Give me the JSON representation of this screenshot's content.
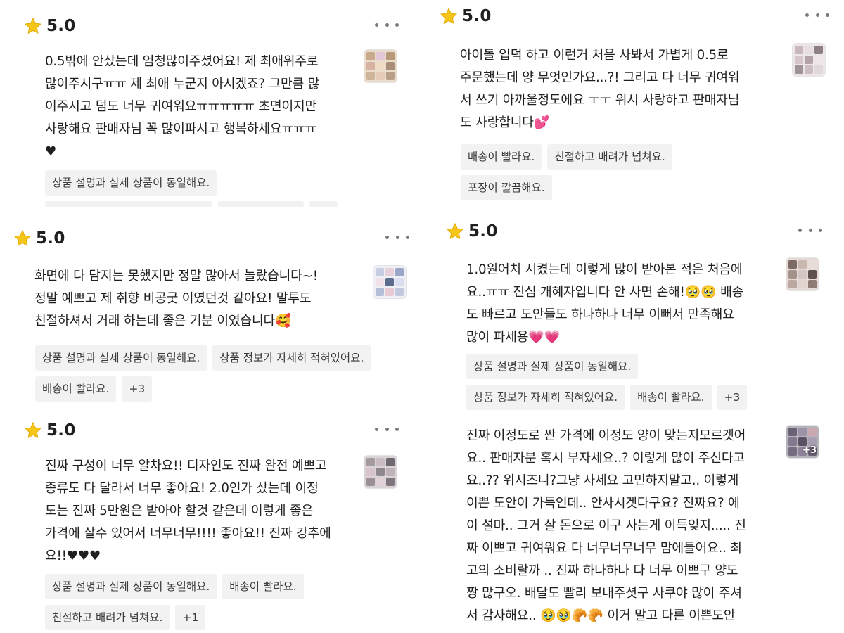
{
  "colors": {
    "star": "#f5c518",
    "tag_bg": "#f2f2f2",
    "text": "#1f1f1f",
    "dots": "#7a7a7a"
  },
  "reviews": [
    {
      "rating": "5.0",
      "text": [
        "0.5밖에 안샀는데 엄청많이주셨어요! 제 최애위주로",
        "많이주시구ㅠㅠ 제 최애 누군지 아시겠죠? 그만큼 많",
        "이주시고 덤도 너무 귀여워요ㅠㅠㅠㅠㅠ 초면이지만",
        "사랑해요 판매자님 꼭 많이파시고 행복하세요ㅠㅠㅠ",
        "♥"
      ],
      "tags": [
        "상품 설명과 실제 상품이 동일해요."
      ],
      "icon": "star-icon"
    },
    {
      "rating": "5.0",
      "text": [
        "화면에 다 담지는 못했지만 정말 많아서 놀랐습니다~!",
        "정말 예쁘고 제 취향 비공굿 이였던것 같아요! 말투도",
        "친절하셔서 거래 하는데 좋은 기분 이였습니다🥰"
      ],
      "tags": [
        "상품 설명과 실제 상품이 동일해요.",
        "상품 정보가 자세히 적혀있어요.",
        "배송이 빨라요.",
        "+3"
      ]
    },
    {
      "rating": "5.0",
      "text": [
        "진짜 구성이 너무 알차요!! 디자인도 진짜 완전 예쁘고",
        "종류도 다 달라서 너무 좋아요! 2.0인가 샀는데 이정",
        "도는 진짜 5만원은 받아야 할것 같은데 이렇게 좋은",
        "가격에 살수 있어서 너무너무!!!! 좋아요!! 진짜 강추에",
        "요!!♥♥♥"
      ],
      "tags": [
        "상품 설명과 실제 상품이 동일해요.",
        "배송이 빨라요.",
        "친절하고 배려가 넘쳐요.",
        "+1"
      ]
    },
    {
      "rating": "5.0",
      "text": [
        "아이돌 입덕 하고 이런거 처음 사봐서 가볍게 0.5로",
        "주문했는데 양 무엇인가요...?! 그리고 다 너무 귀여워",
        "서 쓰기 아까울정도에요 ㅜㅜ 위시 사랑하고 판매자님",
        "도 사랑합니다💕"
      ],
      "tags": [
        "배송이 빨라요.",
        "친절하고 배려가 넘쳐요.",
        "포장이 깔끔해요."
      ]
    },
    {
      "rating": "5.0",
      "text": [
        "1.0원어치 시켰는데 이렇게 많이 받아본 적은 처음에",
        "요..ㅠㅠ 진심 개혜자입니다 안 사면 손해!🥹🥹 배송",
        "도 빠르고 도안들도 하나하나 너무 이뻐서 만족해요",
        "많이 파세용💗💗"
      ],
      "tags": [
        "상품 설명과 실제 상품이 동일해요.",
        "상품 정보가 자세히 적혀있어요.",
        "배송이 빨라요.",
        "+3"
      ]
    },
    {
      "text": [
        "진짜 이정도로 싼 가격에 이정도 양이 맞는지모르겟어",
        "요.. 판매자분 혹시 부자세요..? 이렇게 많이 주신다고",
        "요..?? 위시즈니?그냥 사세요 고민하지말고.. 이렇게",
        "이쁜 도안이 가득인데.. 안사시겟다구요? 진짜요? 에",
        "이 설마.. 그거 살 돈으로 이구 사는게 이득잊지..... 진",
        "짜 이쁘고 귀여워요 다 너무너무너무 맘에들어요.. 최",
        "고의 소비랄까 .. 진짜 하나하나 다 너무 이쁘구 양도",
        "짱 많구오. 배달도 빨리 보내주셧구 사쿠야 많이 주셔",
        "서 감사해요.. 🥹🥹🥐🥐 이거 말고 다른 이쁜도안"
      ],
      "photo_more": "+3"
    }
  ]
}
